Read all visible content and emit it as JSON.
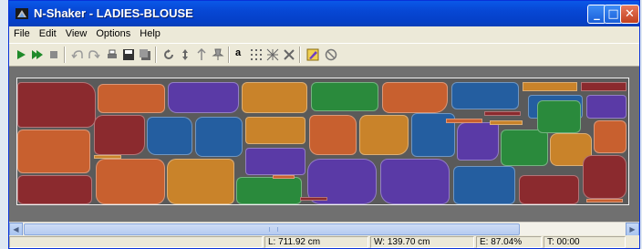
{
  "window": {
    "title": "N-Shaker - LADIES-BLOUSE",
    "app_icon": "n-shaker-logo-icon"
  },
  "title_buttons": [
    {
      "name": "minimize-icon",
      "glyph": "_"
    },
    {
      "name": "maximize-icon",
      "glyph": "□"
    },
    {
      "name": "close-icon",
      "glyph": "✕"
    }
  ],
  "menu": [
    "File",
    "Edit",
    "View",
    "Options",
    "Help"
  ],
  "toolbar": {
    "icons": [
      "play-icon",
      "play-forward-icon",
      "stop-icon",
      "undo-icon",
      "redo-icon",
      "print-icon",
      "save-icon",
      "save-all-icon",
      "rotate-icon",
      "flip-vertical-icon",
      "nudge-icon",
      "pin-icon",
      "text-a-icon",
      "grid-dots-icon",
      "grid-pattern-icon",
      "grid-cross-icon",
      "edit-pencil-icon",
      "no-entry-icon"
    ],
    "text_a_label": "a"
  },
  "status": {
    "length": "L: 711.92 cm",
    "width": "W: 139.70 cm",
    "efficiency": "E: 87.04%",
    "time": "T: 00:00"
  },
  "colors": {
    "title_bar": "#0a4fd9",
    "canvas_bg": "#5a5a5a",
    "workarea_bg": "#707070",
    "piece_maroon": "#8b2a2e",
    "piece_orange": "#c8602f",
    "piece_purple": "#5a3aa6",
    "piece_gold": "#c9832a",
    "piece_green": "#2a8a3c",
    "piece_blue": "#245ea0"
  }
}
